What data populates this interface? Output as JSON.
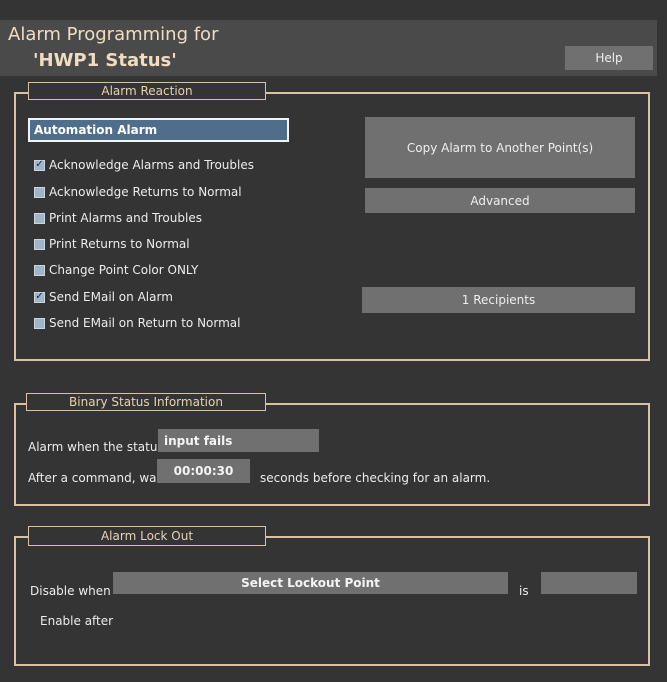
{
  "header": {
    "title_line1": "Alarm Programming for",
    "title_line2": "'HWP1 Status'",
    "help_label": "Help"
  },
  "alarm_reaction": {
    "group_label": "Alarm Reaction",
    "alarm_type": "Automation Alarm",
    "checkboxes": [
      {
        "label": "Acknowledge Alarms and Troubles",
        "checked": true
      },
      {
        "label": "Acknowledge Returns to Normal",
        "checked": false
      },
      {
        "label": "Print Alarms and Troubles",
        "checked": false
      },
      {
        "label": "Print Returns to Normal",
        "checked": false
      },
      {
        "label": "Change Point Color ONLY",
        "checked": false
      },
      {
        "label": "Send EMail on Alarm",
        "checked": true
      },
      {
        "label": "Send EMail on Return to Normal",
        "checked": false
      }
    ],
    "copy_label": "Copy Alarm to Another Point(s)",
    "advanced_label": "Advanced",
    "recipients_label": "1 Recipients"
  },
  "binary_status": {
    "group_label": "Binary Status Information",
    "alarm_when_label": "Alarm when the status",
    "status_value": "input fails",
    "after_command_label": "After a command, wait",
    "wait_value": "00:00:30",
    "seconds_label": "seconds before checking for an alarm."
  },
  "lockout": {
    "group_label": "Alarm Lock Out",
    "disable_label": "Disable when",
    "select_point_label": "Select Lockout Point",
    "is_label": "is",
    "is_value": "",
    "enable_label": "Enable after"
  },
  "colors": {
    "background": "#343434",
    "header_bg": "#4a4a4a",
    "frame_border": "#d8c2a4",
    "title_text": "#f0dcc0",
    "button_bg": "#707070",
    "select_bg": "#4e6e8c",
    "checkbox_fill": "#9fb6ca"
  },
  "icons": {
    "check_mark": "check-mark-icon"
  }
}
